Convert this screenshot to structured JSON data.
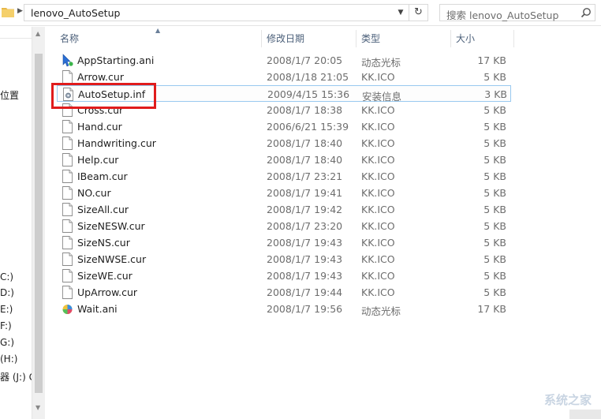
{
  "address": {
    "path": "lenovo_AutoSetup"
  },
  "search": {
    "placeholder": "搜索 lenovo_AutoSetup"
  },
  "nav": {
    "items": [
      {
        "label": "位置"
      },
      {
        "label": "C:)"
      },
      {
        "label": "D:)"
      },
      {
        "label": "E:)"
      },
      {
        "label": "F:)"
      },
      {
        "label": "G:)"
      },
      {
        "label": "(H:)"
      },
      {
        "label": "器 (J:) G"
      }
    ]
  },
  "columns": {
    "name": "名称",
    "date": "修改日期",
    "type": "类型",
    "size": "大小"
  },
  "files": [
    {
      "name": "AppStarting.ani",
      "date": "2008/1/7 20:05",
      "type": "动态光标",
      "size": "17 KB",
      "icon": "animated-cursor-icon"
    },
    {
      "name": "Arrow.cur",
      "date": "2008/1/18 21:05",
      "type": "KK.ICO",
      "size": "5 KB",
      "icon": "file-icon"
    },
    {
      "name": "AutoSetup.inf",
      "date": "2009/4/15 15:36",
      "type": "安装信息",
      "size": "3 KB",
      "icon": "setup-info-icon"
    },
    {
      "name": "Cross.cur",
      "date": "2008/1/7 18:38",
      "type": "KK.ICO",
      "size": "5 KB",
      "icon": "file-icon"
    },
    {
      "name": "Hand.cur",
      "date": "2006/6/21 15:39",
      "type": "KK.ICO",
      "size": "5 KB",
      "icon": "file-icon"
    },
    {
      "name": "Handwriting.cur",
      "date": "2008/1/7 18:40",
      "type": "KK.ICO",
      "size": "5 KB",
      "icon": "file-icon"
    },
    {
      "name": "Help.cur",
      "date": "2008/1/7 18:40",
      "type": "KK.ICO",
      "size": "5 KB",
      "icon": "file-icon"
    },
    {
      "name": "IBeam.cur",
      "date": "2008/1/7 23:21",
      "type": "KK.ICO",
      "size": "5 KB",
      "icon": "file-icon"
    },
    {
      "name": "NO.cur",
      "date": "2008/1/7 19:41",
      "type": "KK.ICO",
      "size": "5 KB",
      "icon": "file-icon"
    },
    {
      "name": "SizeAll.cur",
      "date": "2008/1/7 19:42",
      "type": "KK.ICO",
      "size": "5 KB",
      "icon": "file-icon"
    },
    {
      "name": "SizeNESW.cur",
      "date": "2008/1/7 23:20",
      "type": "KK.ICO",
      "size": "5 KB",
      "icon": "file-icon"
    },
    {
      "name": "SizeNS.cur",
      "date": "2008/1/7 19:43",
      "type": "KK.ICO",
      "size": "5 KB",
      "icon": "file-icon"
    },
    {
      "name": "SizeNWSE.cur",
      "date": "2008/1/7 19:43",
      "type": "KK.ICO",
      "size": "5 KB",
      "icon": "file-icon"
    },
    {
      "name": "SizeWE.cur",
      "date": "2008/1/7 19:43",
      "type": "KK.ICO",
      "size": "5 KB",
      "icon": "file-icon"
    },
    {
      "name": "UpArrow.cur",
      "date": "2008/1/7 19:44",
      "type": "KK.ICO",
      "size": "5 KB",
      "icon": "file-icon"
    },
    {
      "name": "Wait.ani",
      "date": "2008/1/7 19:56",
      "type": "动态光标",
      "size": "17 KB",
      "icon": "animated-wait-icon"
    }
  ],
  "selected_index": 2,
  "watermark": "系统之家",
  "colors": {
    "highlight": "#e01c1c",
    "selection_border": "#99c9ef",
    "header_text": "#4c607a"
  }
}
